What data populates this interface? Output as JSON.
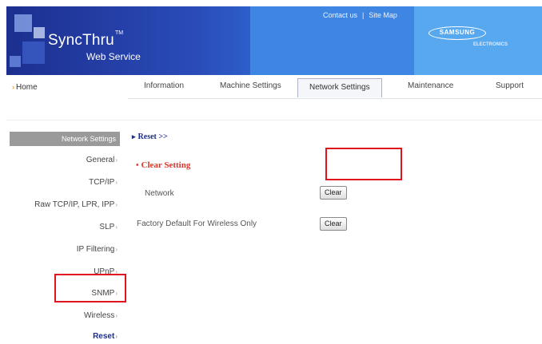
{
  "header": {
    "logo_main": "SyncThru",
    "logo_tm": "TM",
    "logo_sub": "Web Service",
    "links": [
      "Contact us",
      "Site Map"
    ],
    "link_separator": "|",
    "brand": "SAMSUNG",
    "brand_sub": "ELECTRONICS"
  },
  "nav": {
    "home": "Home",
    "tabs": [
      "Information",
      "Machine Settings",
      "Network Settings",
      "Maintenance",
      "Support"
    ],
    "active_tab": "Network Settings"
  },
  "sidebar": {
    "title": "Network Settings",
    "items": [
      "General",
      "TCP/IP",
      "Raw TCP/IP, LPR, IPP",
      "SLP",
      "IP Filtering",
      "UPnP",
      "SNMP",
      "Wireless",
      "Reset"
    ],
    "current": "Reset"
  },
  "main": {
    "breadcrumb": "Reset >>",
    "section_title": "Clear Setting",
    "rows": [
      {
        "label": "Network",
        "button": "Clear"
      },
      {
        "label": "Factory Default For Wireless Only",
        "button": "Clear"
      }
    ]
  },
  "colors": {
    "banner_dark": "#1c2f8f",
    "banner_light": "#4ea0ee",
    "section_red": "#d8372a",
    "annotation_red": "#e0141c",
    "sidebar_header": "#9a9a9a"
  }
}
